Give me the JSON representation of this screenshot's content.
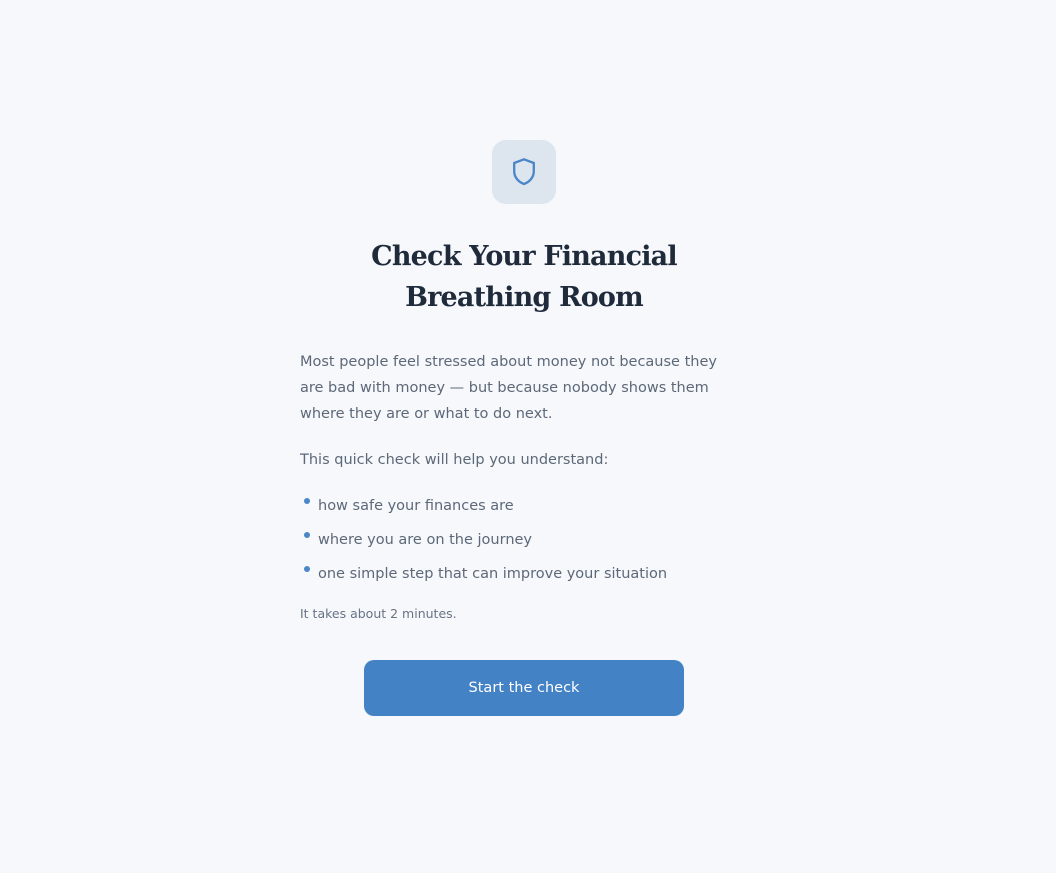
{
  "header": {
    "icon": "shield-icon",
    "title": "Check Your Financial Breathing Room"
  },
  "main": {
    "description": "Most people feel stressed about money not because they are bad with money — but because nobody shows them where they are or what to do next.",
    "intro": "This quick check will help you understand:",
    "bullets": [
      "how safe your finances are",
      "where you are on the journey",
      "one simple step that can improve your situation"
    ],
    "duration_note": "It takes about 2 minutes."
  },
  "cta": {
    "label": "Start the check"
  },
  "colors": {
    "background": "#f6f8fb",
    "accent": "#4482c6",
    "icon_badge": "#dde5ee",
    "title": "#1f2a3b",
    "body_text": "#5d6878"
  }
}
